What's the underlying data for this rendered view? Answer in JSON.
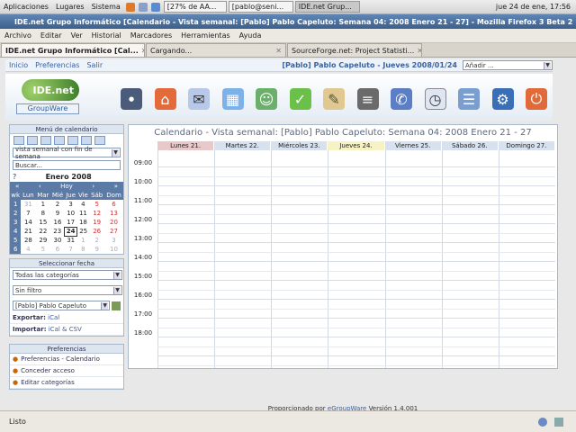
{
  "panel": {
    "apps": "Aplicaciones",
    "places": "Lugares",
    "system": "Sistema",
    "tasks": [
      "[27% de AA...",
      "[pablo@seni...",
      "IDE.net Grup..."
    ],
    "clock": "jue 24 de ene, 17:56"
  },
  "window": {
    "title": "IDE.net Grupo Informático [Calendario - Vista semanal: [Pablo] Pablo Capeluto: Semana 04: 2008 Enero 21 - 27] - Mozilla Firefox 3 Beta 2"
  },
  "menu": [
    "Archivo",
    "Editar",
    "Ver",
    "Historial",
    "Marcadores",
    "Herramientas",
    "Ayuda"
  ],
  "tabs": [
    {
      "label": "IDE.net Grupo Informático [Cal...",
      "active": true
    },
    {
      "label": "Cargando...",
      "active": false
    },
    {
      "label": "SourceForge.net: Project Statisti...",
      "active": false
    }
  ],
  "appnav": {
    "links": [
      "Inicio",
      "Preferencias",
      "Salir"
    ],
    "user": "[Pablo] Pablo Capeluto - Jueves 2008/01/24",
    "add_select": "Añadir ..."
  },
  "logo": {
    "name": "IDE.net",
    "sub": "GroupWare"
  },
  "header_icons": [
    "cms-icon",
    "home-icon",
    "email-icon",
    "calendar-icon",
    "contacts-icon",
    "tasks-icon",
    "clipboard-icon",
    "projects-icon",
    "support-icon",
    "clock-icon",
    "list-icon",
    "settings-icon",
    "logout-icon"
  ],
  "sidebar": {
    "menu_title": "Menú de calendario",
    "view_select": "vista semanal con fin de semana",
    "search_placeholder": "Buscar...",
    "mini_cal": {
      "q": "?",
      "month": "Enero 2008",
      "prev_year": "«",
      "prev": "‹",
      "today_label": "Hoy",
      "next": "›",
      "next_year": "»",
      "headers": [
        "wk",
        "Lun",
        "Mar",
        "Mié",
        "Jue",
        "Vie",
        "Sáb",
        "Dom"
      ],
      "weeks": [
        {
          "wk": "1",
          "days": [
            "31",
            "1",
            "2",
            "3",
            "4",
            "5",
            "6"
          ]
        },
        {
          "wk": "2",
          "days": [
            "7",
            "8",
            "9",
            "10",
            "11",
            "12",
            "13"
          ]
        },
        {
          "wk": "3",
          "days": [
            "14",
            "15",
            "16",
            "17",
            "18",
            "19",
            "20"
          ]
        },
        {
          "wk": "4",
          "days": [
            "21",
            "22",
            "23",
            "24",
            "25",
            "26",
            "27"
          ]
        },
        {
          "wk": "5",
          "days": [
            "28",
            "29",
            "30",
            "31",
            "1",
            "2",
            "3"
          ]
        },
        {
          "wk": "6",
          "days": [
            "4",
            "5",
            "6",
            "7",
            "8",
            "9",
            "10"
          ]
        }
      ]
    },
    "select_date": "Seleccionar fecha",
    "categories": "Todas las categorías",
    "filter": "Sin filtro",
    "owner": "[Pablo] Pablo Capeluto",
    "export_label": "Exportar:",
    "export_val": "iCal",
    "import_label": "Importar:",
    "import_val": "iCal & CSV",
    "prefs_title": "Preferencias",
    "prefs": [
      "Preferencias - Calendario",
      "Conceder acceso",
      "Editar categorías"
    ]
  },
  "calendar": {
    "title": "Calendario - Vista semanal: [Pablo] Pablo Capeluto: Semana 04: 2008 Enero 21 - 27",
    "days": [
      "Lunes 21.",
      "Martes 22.",
      "Miércoles 23.",
      "Jueves 24.",
      "Viernes 25.",
      "Sábado 26.",
      "Domingo 27."
    ],
    "day_colors": [
      "#e8c8c8",
      "#d7e2ee",
      "#d7e2ee",
      "#f6f2c4",
      "#d7e2ee",
      "#d7e2ee",
      "#d7e2ee"
    ],
    "hours": [
      "09:00",
      "10:00",
      "11:00",
      "12:00",
      "13:00",
      "14:00",
      "15:00",
      "16:00",
      "17:00",
      "18:00"
    ]
  },
  "footer": {
    "prefix": "Proporcionado por",
    "link": "eGroupWare",
    "suffix": "Versión 1.4.001"
  },
  "status": "Listo"
}
